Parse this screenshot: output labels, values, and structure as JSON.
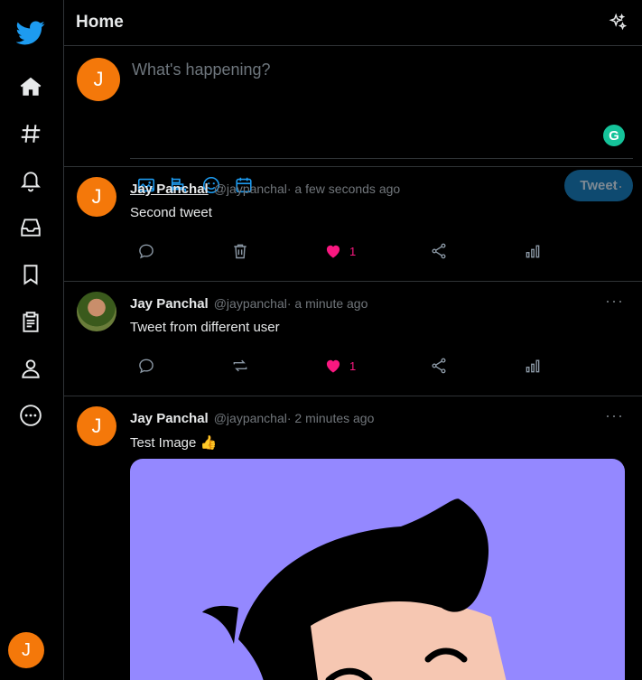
{
  "header": {
    "title": "Home"
  },
  "composer": {
    "avatar_letter": "J",
    "placeholder": "What's happening?",
    "tweet_button": "Tweet"
  },
  "sidebar": {
    "items": [
      {
        "name": "home-icon"
      },
      {
        "name": "explore-hash-icon"
      },
      {
        "name": "notifications-bell-icon"
      },
      {
        "name": "messages-inbox-icon"
      },
      {
        "name": "bookmarks-icon"
      },
      {
        "name": "lists-icon"
      },
      {
        "name": "profile-icon"
      },
      {
        "name": "more-icon"
      }
    ],
    "user_avatar_letter": "J"
  },
  "tweets": [
    {
      "avatar_letter": "J",
      "name": "Jay Panchal",
      "handle": "@jaypanchal",
      "time": "· a few seconds ago",
      "text": "Second tweet",
      "likes": "1"
    },
    {
      "avatar_letter": "",
      "name": "Jay Panchal",
      "handle": "@jaypanchal",
      "time": "· a minute ago",
      "text": "Tweet from different user",
      "likes": "1"
    },
    {
      "avatar_letter": "J",
      "name": "Jay Panchal",
      "handle": "@jaypanchal",
      "time": "· 2 minutes ago",
      "text": "Test Image 👍"
    }
  ],
  "colors": {
    "accent": "#1d9bf0",
    "like": "#f91880",
    "avatar": "#f4780a",
    "image_bg": "#9488ff"
  }
}
